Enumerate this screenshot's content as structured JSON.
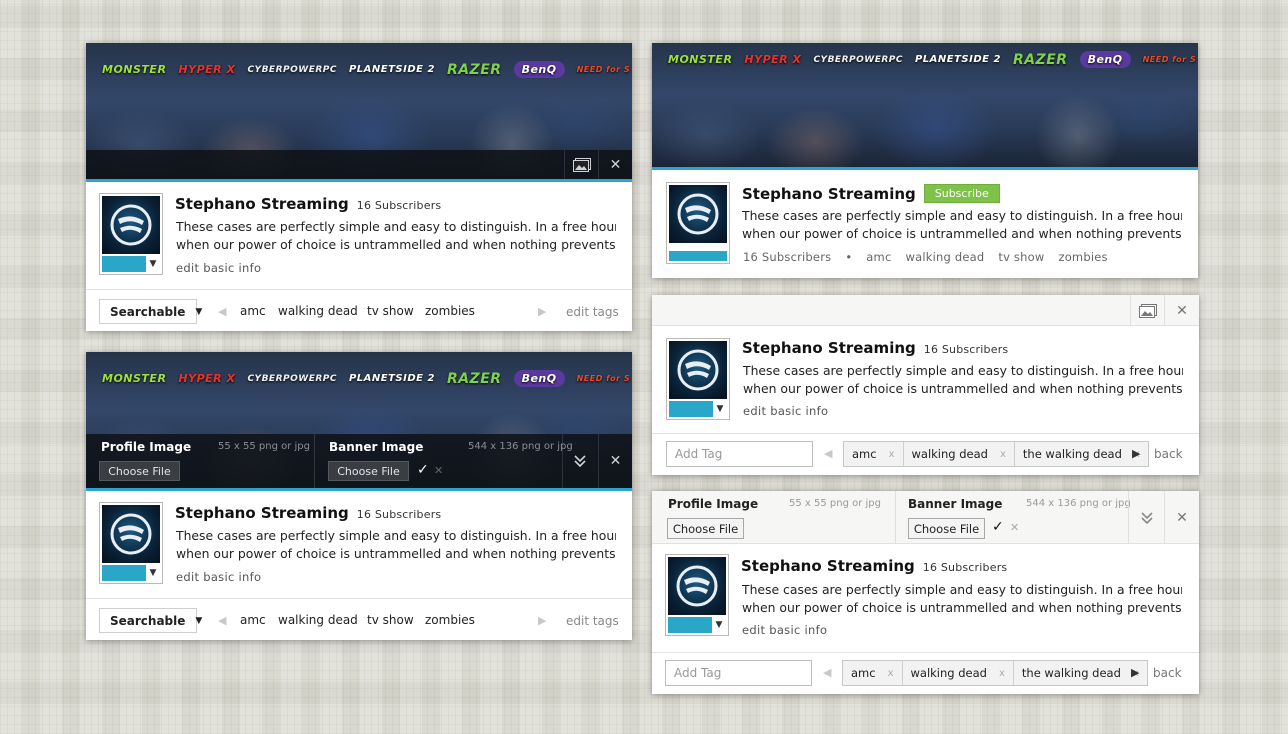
{
  "channel": {
    "name": "Stephano Streaming",
    "subscribers": "16 Subscribers",
    "description_line1": "These cases are perfectly simple and easy to distinguish. In a free hour,",
    "description_line2": "when our power of choice is untrammelled and when nothing prevents our",
    "edit_basic_info": "edit basic info"
  },
  "banner": {
    "sponsors": [
      "MONSTER",
      "HYPER X",
      "CYBERPOWERPC",
      "PLANETSIDE 2",
      "RAZER",
      "BenQ",
      "NEED for S"
    ]
  },
  "colors": {
    "accent": "#2aa6c9",
    "subscribe": "#7fc24a",
    "dark_bar": "#0f1218"
  },
  "icons": {
    "image": "image-icon",
    "close": "close-icon",
    "collapse": "double-chevron-down-icon",
    "check": "checkmark-icon"
  },
  "footer": {
    "visibility": "Searchable",
    "tags": [
      "amc",
      "walking dead",
      "tv show",
      "zombies"
    ],
    "edit_tags": "edit tags"
  },
  "upload": {
    "profile_label": "Profile Image",
    "profile_hint": "55 x 55 png or jpg",
    "banner_label": "Banner Image",
    "banner_hint": "544 x 136 png or jpg",
    "choose_file": "Choose File"
  },
  "subscribe_label": "Subscribe",
  "tag_editor": {
    "placeholder": "Add Tag",
    "tags": [
      "amc",
      "walking dead",
      "the walking dead"
    ],
    "remove": "x",
    "back": "back"
  },
  "glyphs": {
    "dropdown": "▼",
    "close": "✕",
    "prev": "◀",
    "next": "▶",
    "check": "✓",
    "bullet": "•",
    "collapse": "⌄"
  }
}
